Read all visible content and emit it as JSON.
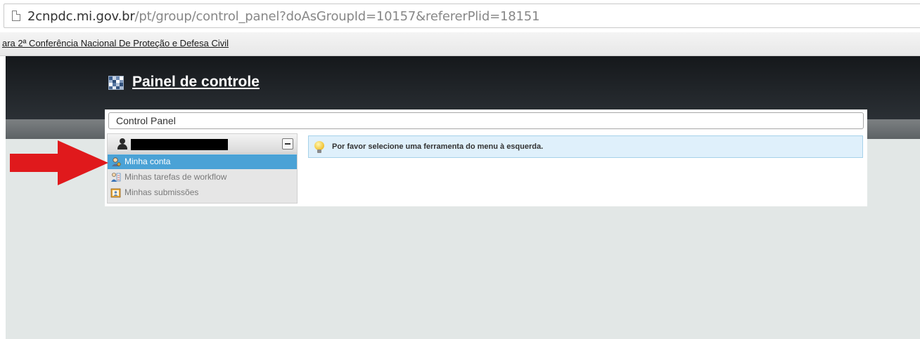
{
  "browser": {
    "url_host": "2cnpdc.mi.gov.br",
    "url_path": "/pt/group/control_panel?doAsGroupId=10157&refererPlid=18151",
    "bookmark": "ara 2ª Conferência Nacional De Proteção e Defesa Civil"
  },
  "header": {
    "title": "Painel de controle"
  },
  "breadcrumb": "Control Panel",
  "menu": {
    "items": [
      {
        "label": "Minha conta",
        "icon": "user-settings-icon",
        "selected": true
      },
      {
        "label": "Minhas tarefas de workflow",
        "icon": "workflow-tasks-icon",
        "selected": false
      },
      {
        "label": "Minhas submissões",
        "icon": "submissions-icon",
        "selected": false
      }
    ]
  },
  "info_message": "Por favor selecione uma ferramenta do menu à esquerda.",
  "colors": {
    "selected_item": "#4aa2d6",
    "arrow": "#e0191c",
    "info_bg": "#dff0fb",
    "header_dark": "#1f2428"
  }
}
